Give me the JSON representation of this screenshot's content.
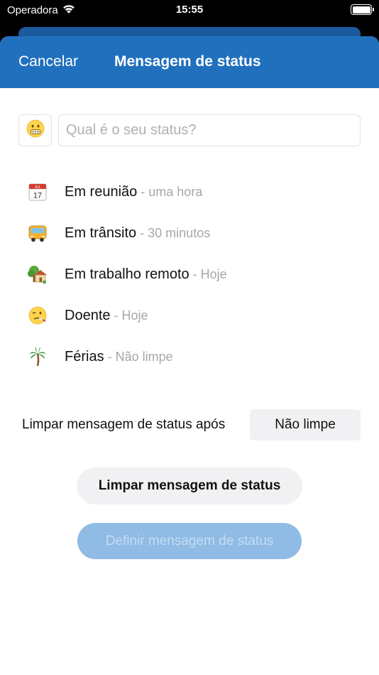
{
  "status_bar": {
    "carrier": "Operadora",
    "time": "15:55",
    "icons": [
      "wifi-icon",
      "battery-icon"
    ]
  },
  "nav": {
    "cancel_label": "Cancelar",
    "title": "Mensagem de status"
  },
  "input": {
    "emoji_icon": "grimacing-face-icon",
    "placeholder": "Qual é o seu status?",
    "value": ""
  },
  "presets": [
    {
      "icon": "calendar-icon",
      "label": "Em reunião",
      "separator": " - ",
      "clear": "uma hora"
    },
    {
      "icon": "bus-icon",
      "label": "Em trânsito",
      "separator": " - ",
      "clear": "30 minutos"
    },
    {
      "icon": "house-icon",
      "label": "Em trabalho remoto",
      "separator": " - ",
      "clear": "Hoje"
    },
    {
      "icon": "sick-face-icon",
      "label": "Doente",
      "separator": " - ",
      "clear": "Hoje"
    },
    {
      "icon": "palm-tree-icon",
      "label": "Férias",
      "separator": " - ",
      "clear": "Não limpe"
    }
  ],
  "clear_after": {
    "label": "Limpar mensagem de status após",
    "value": "Não limpe"
  },
  "buttons": {
    "clear_label": "Limpar mensagem de status",
    "set_label": "Definir mensagem de status"
  },
  "colors": {
    "nav_background": "#2170be",
    "set_button_disabled": "#8fbbe4",
    "secondary_text": "#a7a7ab"
  }
}
